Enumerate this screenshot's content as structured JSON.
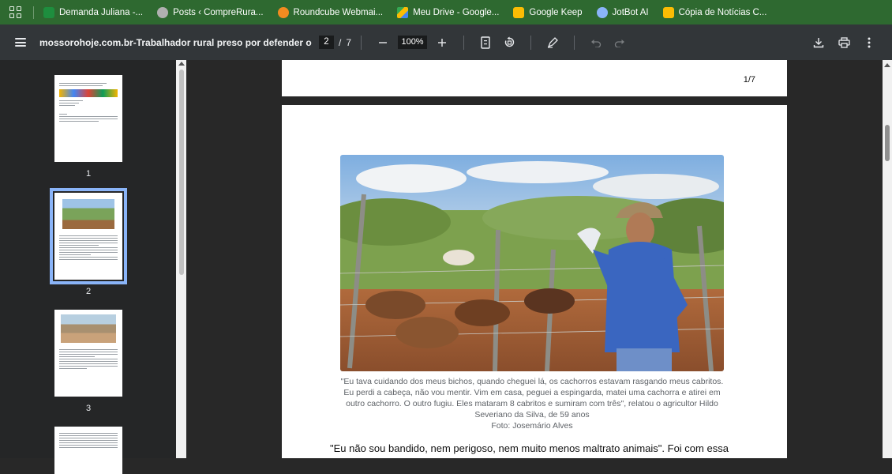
{
  "bookmarks": [
    {
      "label": "Demanda Juliana -...",
      "icon": "sheets-icon",
      "color": "#1e8e3e"
    },
    {
      "label": "Posts ‹ CompreRura...",
      "icon": "wordpress-icon",
      "color": "#b0b0b0"
    },
    {
      "label": "Roundcube Webmai...",
      "icon": "roundcube-icon",
      "color": "#f28b20"
    },
    {
      "label": "Meu Drive - Google...",
      "icon": "drive-icon",
      "color": "#fbbc04"
    },
    {
      "label": "Google Keep",
      "icon": "keep-icon",
      "color": "#fbbc04"
    },
    {
      "label": "JotBot AI",
      "icon": "jotbot-icon",
      "color": "#8ab4f8"
    },
    {
      "label": "Cópia de Notícias C...",
      "icon": "slides-icon",
      "color": "#fbbc04"
    }
  ],
  "toolbar": {
    "title": "mossorohoje.com.br-Trabalhador rural preso por defender o seu re...",
    "current_page": "2",
    "separator": "/",
    "total_pages": "7",
    "zoom": "100%"
  },
  "thumbnails": [
    {
      "number": "1"
    },
    {
      "number": "2",
      "selected": true
    },
    {
      "number": "3"
    }
  ],
  "page1": {
    "page_indicator": "1/7"
  },
  "page2": {
    "caption": "\"Eu tava cuidando dos meus bichos, quando cheguei lá, os cachorros estavam rasgando meus cabritos. Eu perdi a cabeça, não vou mentir. Vim em casa, peguei a espingarda, matei uma cachorra e atirei em outro cachorro. O outro fugiu. Eles mataram 8 cabritos e sumiram com três\", relatou o agricultor Hildo Severiano da Silva, de 59 anos",
    "credit": "Foto: Josemário Alves",
    "body": "\"Eu não sou bandido, nem perigoso, nem muito menos maltrato animais\". Foi com essa"
  },
  "colors": {
    "bookmarks_bar": "#2e6930",
    "toolbar": "#323639",
    "viewer_bg": "#282828",
    "selected_thumb_outline": "#8ab4f8"
  }
}
